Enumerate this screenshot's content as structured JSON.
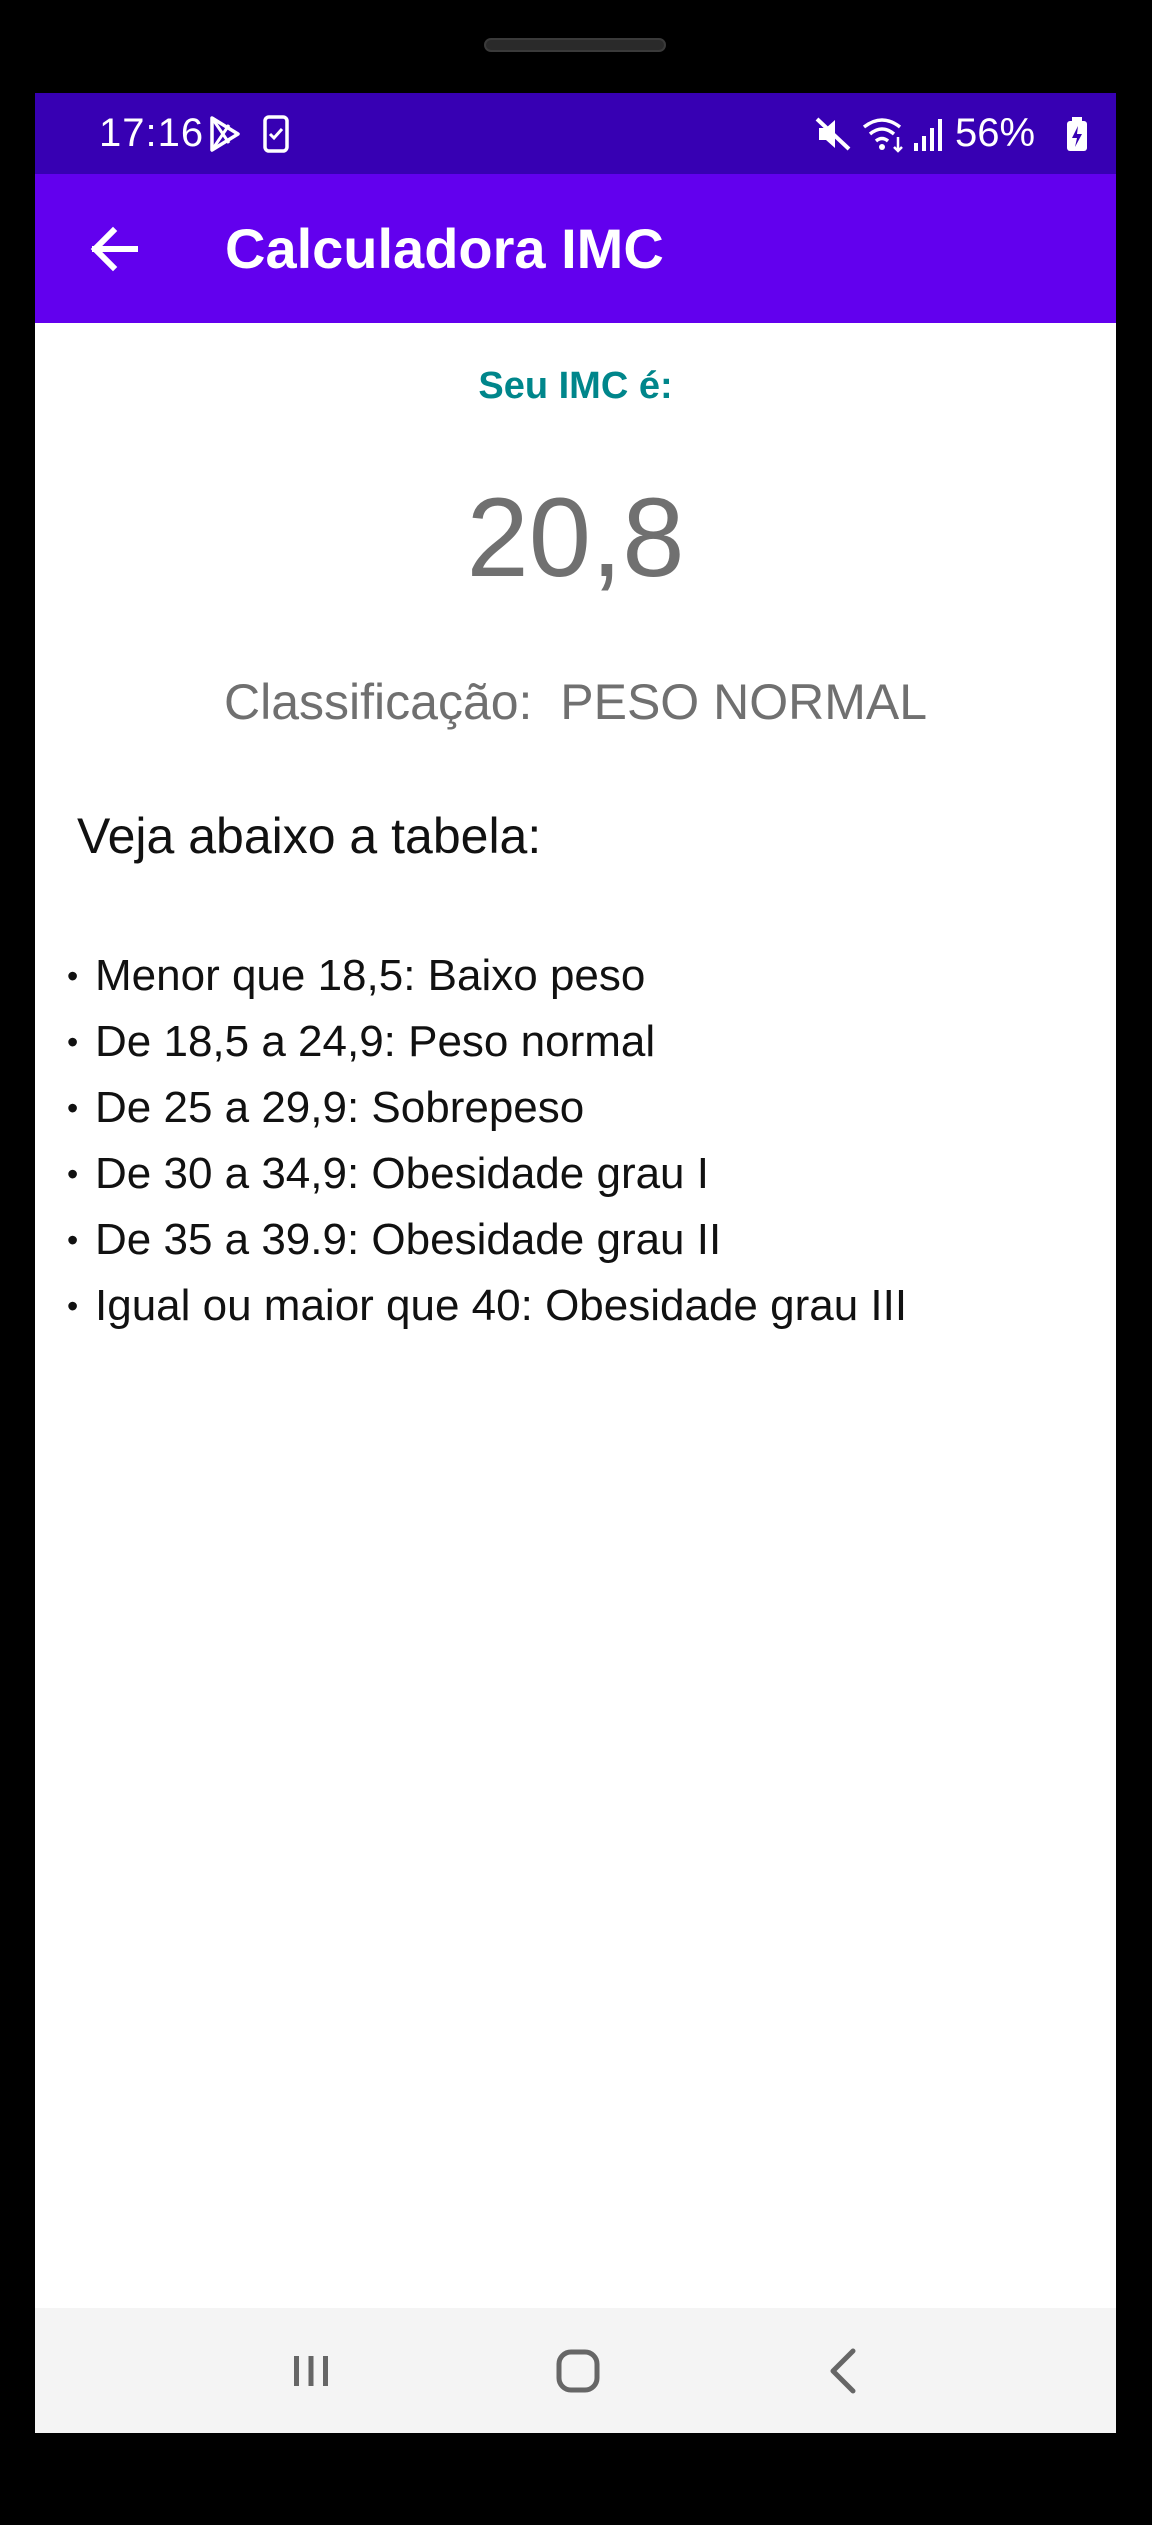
{
  "status_bar": {
    "time": "17:16",
    "battery_percent": "56%",
    "icons": [
      "play-store-icon",
      "phone-check-icon",
      "mute-icon",
      "wifi-icon",
      "signal-icon",
      "battery-charging-icon"
    ]
  },
  "app_bar": {
    "title": "Calculadora IMC",
    "back_icon": "arrow-back-icon"
  },
  "result": {
    "label": "Seu IMC é:",
    "value": "20,8",
    "classification_label": "Classificação:",
    "classification_value": "PESO NORMAL"
  },
  "table": {
    "heading": "Veja abaixo a tabela:",
    "bullet": "•",
    "items": [
      "Menor que 18,5: Baixo peso",
      "De 18,5 a 24,9: Peso normal",
      "De 25 a 29,9: Sobrepeso",
      "De 30 a 34,9: Obesidade grau I",
      "De 35 a 39.9: Obesidade grau II",
      "Igual ou maior que 40: Obesidade grau III"
    ]
  },
  "nav_bar": {
    "recents_icon": "recents-icon",
    "home_icon": "home-icon",
    "back_icon": "nav-back-icon"
  },
  "colors": {
    "status_bar": "#3700B3",
    "app_bar": "#6200EE",
    "label_accent": "#00868B",
    "muted_text": "#707070"
  }
}
